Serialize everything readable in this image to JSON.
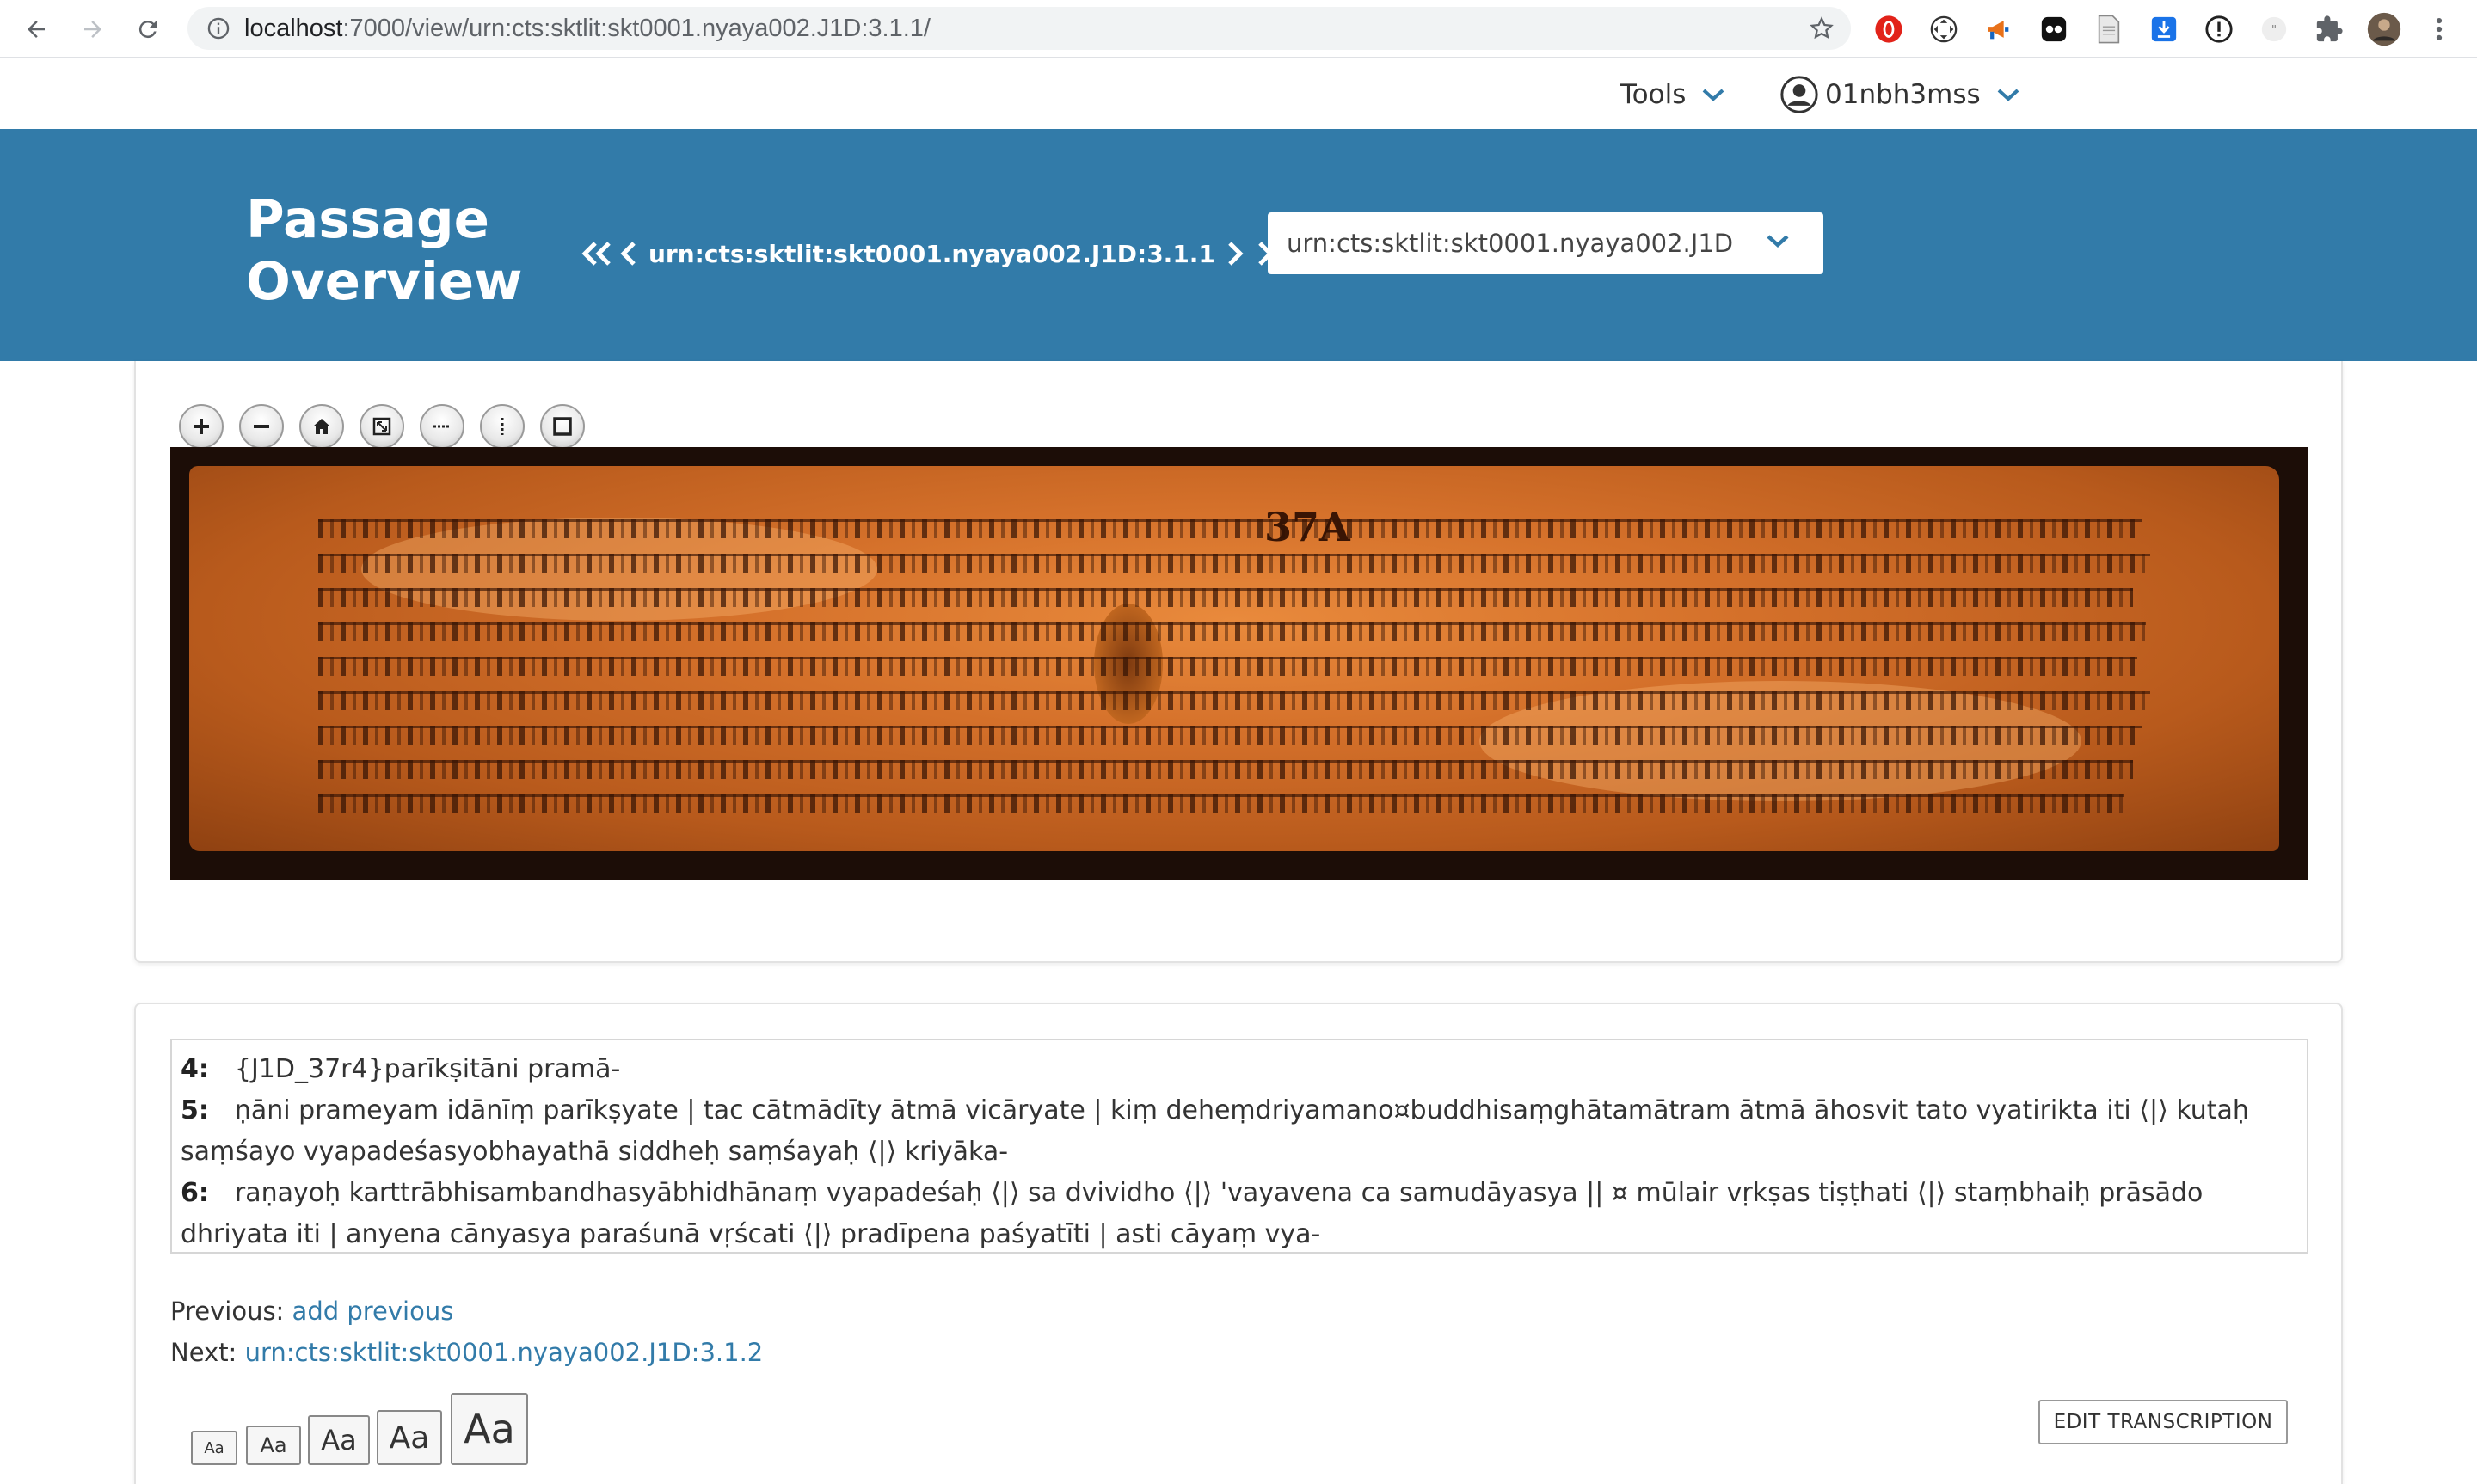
{
  "browser": {
    "url_host": "localhost",
    "url_rest": ":7000/view/urn:cts:sktlit:skt0001.nyaya002.J1D:3.1.1/",
    "extensions": [
      "opera-icon",
      "move-icon",
      "megaphone-icon",
      "panda-icon",
      "document-icon",
      "download-icon",
      "info-icon",
      "quote-icon",
      "puzzle-icon",
      "profile-avatar"
    ]
  },
  "topbar": {
    "tools_label": "Tools",
    "user_label": "01nbh3mss"
  },
  "hero": {
    "title": "Passage Overview",
    "urn": "urn:cts:sktlit:skt0001.nyaya002.J1D:3.1.1",
    "select_value": "urn:cts:sktlit:skt0001.nyaya002.J1D:",
    "background": "#327ba9"
  },
  "viewer": {
    "tools": [
      "zoom-in-icon",
      "zoom-out-icon",
      "home-icon",
      "fullpage-icon",
      "horizontal-icon",
      "vertical-icon",
      "fit-icon"
    ],
    "folio_label": "37A"
  },
  "transcription": {
    "lines": [
      {
        "num": "4:",
        "text": "{J1D_37r4}parīkṣitāni pramā-",
        "cont": ""
      },
      {
        "num": "5:",
        "text": "ṇāni prameyam idānīṃ parīkṣyate | tac cātmādīty ātmā vicāryate | kiṃ deheṃdriyamano¤buddhisaṃghātamātram ātmā āhosvit tato vyatirikta iti  ⟨|⟩  kutaḥ",
        "cont": "saṃśayo vyapadeśasyobhayathā siddheḥ saṃśayaḥ  ⟨|⟩  kriyāka-"
      },
      {
        "num": "6:",
        "text": "raṇayoḥ karttrābhisambandhasyābhidhānaṃ vyapadeśaḥ  ⟨|⟩  sa dvividho  ⟨|⟩  'vayavena ca samudāyasya || ¤ mūlair vṛkṣas tiṣṭhati  ⟨|⟩  staṃbhaiḥ prāsādo",
        "cont": "dhriyata iti | anyena cānyasya paraśunā vṛścati  ⟨|⟩  pradīpena paśyatīti | asti cāyaṃ vya-"
      }
    ],
    "previous_label": "Previous:",
    "previous_link": "add previous",
    "next_label": "Next:",
    "next_link": "urn:cts:sktlit:skt0001.nyaya002.J1D:3.1.2",
    "font_buttons": [
      "Aa",
      "Aa",
      "Aa",
      "Aa",
      "Aa"
    ],
    "edit_label": "EDIT TRANSCRIPTION",
    "link_color": "#327ba9"
  }
}
